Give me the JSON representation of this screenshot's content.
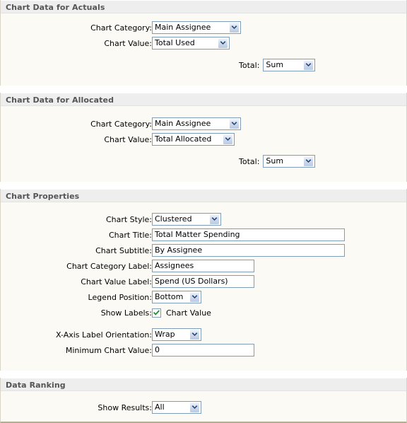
{
  "sections": [
    {
      "id": "chart-data-actuals",
      "title": "Chart Data for Actuals",
      "fields": {
        "chart_category_label": "Chart Category:",
        "chart_category_value": "Main Assignee",
        "chart_value_label": "Chart Value:",
        "chart_value_value": "Total Used",
        "total_label": "Total:",
        "total_value": "Sum"
      }
    },
    {
      "id": "chart-data-allocated",
      "title": "Chart Data for Allocated",
      "fields": {
        "chart_category_label": "Chart Category:",
        "chart_category_value": "Main Assignee",
        "chart_value_label": "Chart Value:",
        "chart_value_value": "Total Allocated",
        "total_label": "Total:",
        "total_value": "Sum"
      }
    },
    {
      "id": "chart-properties",
      "title": "Chart Properties",
      "fields": {
        "chart_style_label": "Chart Style:",
        "chart_style_value": "Clustered",
        "chart_title_label": "Chart Title:",
        "chart_title_value": "Total Matter Spending",
        "chart_subtitle_label": "Chart Subtitle:",
        "chart_subtitle_value": "By Assignee",
        "chart_category_label_label": "Chart Category Label:",
        "chart_category_label_value": "Assignees",
        "chart_value_label_label": "Chart Value Label:",
        "chart_value_label_value": "Spend (US Dollars)",
        "legend_position_label": "Legend Position:",
        "legend_position_value": "Bottom",
        "show_labels_label": "Show Labels:",
        "show_labels_checkbox_label": "Chart Value",
        "show_labels_checked": true,
        "x_axis_orientation_label": "X-Axis Label Orientation:",
        "x_axis_orientation_value": "Wrap",
        "minimum_chart_value_label": "Minimum Chart Value:",
        "minimum_chart_value_value": "0"
      }
    },
    {
      "id": "data-ranking",
      "title": "Data Ranking",
      "fields": {
        "show_results_label": "Show Results:",
        "show_results_value": "All"
      }
    }
  ],
  "colors": {
    "section_header_bg": "#eeeeee",
    "section_header_text": "#555555",
    "panel_bg": "#fbfaf5",
    "input_border": "#7f9db9",
    "dropdown_arrow": "#1f3f6e",
    "checkmark": "#1a8d28",
    "page_bg": "#ffffff",
    "bottom_border": "#b3ad96"
  },
  "icons": {
    "dropdown_arrow": "chevron-down-icon",
    "checkmark": "check-icon"
  }
}
